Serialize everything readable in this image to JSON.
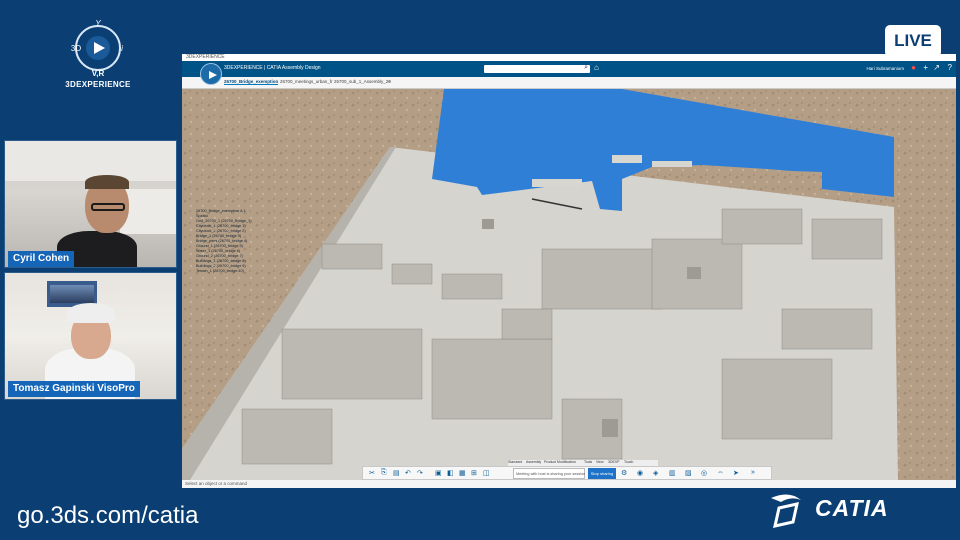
{
  "logo": {
    "top_mark": "Y",
    "left_mark": "3D",
    "right_mark": "i",
    "bottom_mark": "V,R",
    "text": "3DEXPERIENCE"
  },
  "live": {
    "label": "LIVE"
  },
  "webcams": [
    {
      "name": "Cyril Cohen"
    },
    {
      "name": "Tomasz Gapinski VisoPro"
    }
  ],
  "app": {
    "window_title": "3DEXPERIENCE",
    "brand": "3DEXPERIENCE | CATIA Assembly Design",
    "user": "Hari Subramanium",
    "tabs": [
      {
        "label": "26700_Bridge_exemption",
        "active": true
      },
      {
        "label": "26700_meetings_urban_fr"
      },
      {
        "label": "26700_sub_1_Assembly_20"
      }
    ],
    "tree_items": [
      "26700_Bridge_exemption A.1",
      "Spatial",
      "Grid_26700_1 (26700_Bridge_1)",
      "Cityblock_1 (26700_bridge 1)",
      "Cityblock_2 (26700_bridge 2)",
      "Bridge_1 (26700_bridge 3)",
      "Bridge_piers (26700_bridge 4)",
      "Ground_1 (26700_bridge 5)",
      "Water_1 (26700_bridge 6)",
      "Ground_2 (26700_bridge 7)",
      "Buildings_1 (26700_bridge 8)",
      "Buildings_2 (26700_bridge 9)",
      "Terrain_1 (26700_bridge 10)"
    ],
    "action_tabs": [
      "Standard",
      "Assembly",
      "Product Modification",
      "Tools",
      "View",
      "3DEXP",
      "Touch"
    ],
    "message_box": "Meeting with host is sharing your session",
    "stop_button": "Stop sharing",
    "status": "Select an object or a command"
  },
  "footer": {
    "url": "go.3ds.com/catia",
    "brand": "CATIA"
  },
  "colors": {
    "background": "#0b3f74",
    "water": "#2f7fd6",
    "terrain": "#b59f86",
    "city": "#d9d7d3",
    "accent": "#1565b8"
  }
}
